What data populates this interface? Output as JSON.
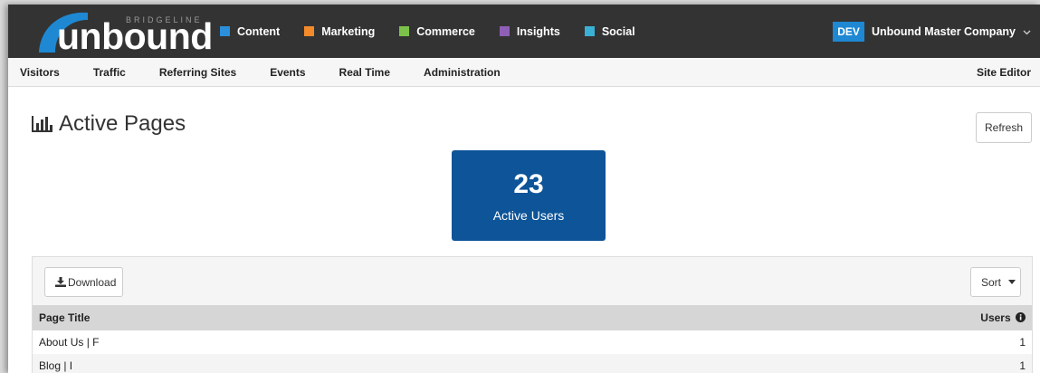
{
  "brand": {
    "small": "BRIDGELINE",
    "wordmark": "unbound",
    "logo_color": "#1e88d3"
  },
  "top_nav": {
    "modules": [
      {
        "label": "Content",
        "color": "#2b8fdb"
      },
      {
        "label": "Marketing",
        "color": "#f58a2b"
      },
      {
        "label": "Commerce",
        "color": "#7cc24a"
      },
      {
        "label": "Insights",
        "color": "#8e5fb5"
      },
      {
        "label": "Social",
        "color": "#3ab1d4"
      }
    ],
    "env_badge": "DEV",
    "company": "Unbound Master Company",
    "company_chevron_icon": "chevron-down-icon"
  },
  "sub_nav": {
    "links": [
      "Visitors",
      "Traffic",
      "Referring Sites",
      "Events",
      "Real Time",
      "Administration"
    ],
    "site_editor": "Site Editor"
  },
  "page": {
    "title": "Active Pages",
    "title_icon": "bar-chart-icon",
    "refresh_label": "Refresh"
  },
  "stat": {
    "value": "23",
    "label": "Active Users",
    "color": "#0d5498"
  },
  "table": {
    "download_label": "Download",
    "download_icon": "download-icon",
    "sort_label": "Sort",
    "columns": [
      "Page Title",
      "Users"
    ],
    "users_info_icon": "info-icon",
    "rows": [
      {
        "title": "About Us | F",
        "users": "1"
      },
      {
        "title": "Blog | I",
        "users": "1"
      }
    ]
  }
}
